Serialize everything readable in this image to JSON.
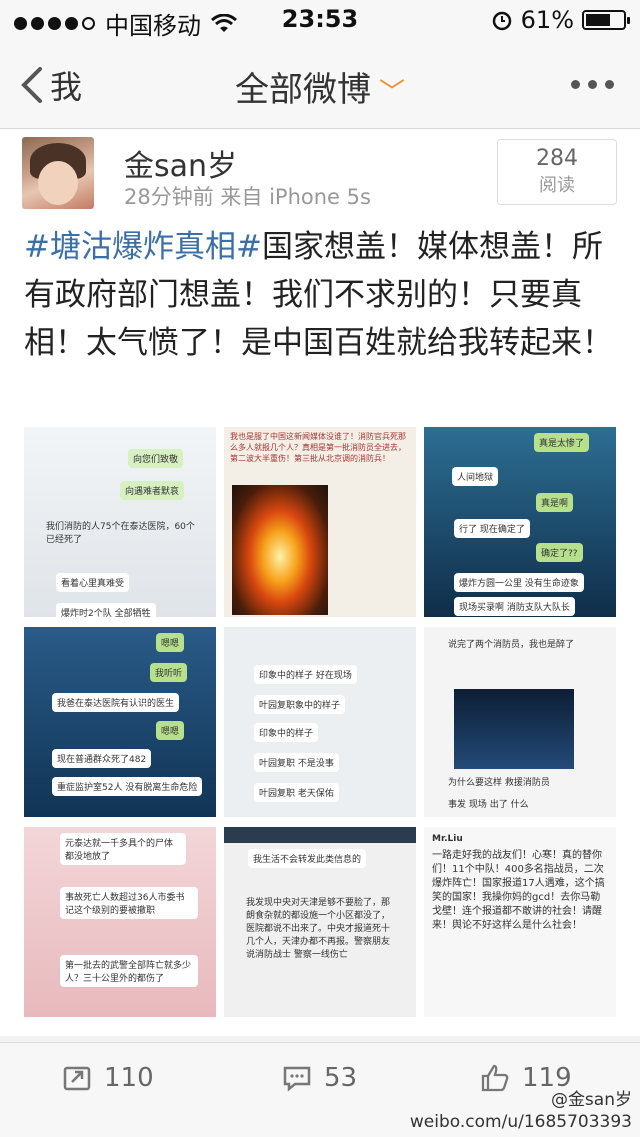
{
  "status": {
    "carrier": "中国移动",
    "time": "23:53",
    "battery": "61%"
  },
  "nav": {
    "back_label": "我",
    "title": "全部微博"
  },
  "post": {
    "username": "金san岁",
    "meta": "28分钟前  来自 iPhone 5s",
    "reads_count": "284",
    "reads_label": "阅读",
    "hashtag": "#塘沽爆炸真相#",
    "text": "国家想盖！媒体想盖！所有政府部门想盖！我们不求别的！只要真相！太气愤了！是中国百姓就给我转起来！"
  },
  "images": [
    {
      "lines": [
        "向您们致敬",
        "向遇难者默哀",
        "我们消防的人75个在泰达医院，60个已经死了",
        "看着心里真难受",
        "爆炸时2个队 全部牺牲"
      ]
    },
    {
      "lines": [
        "我也是服了中国这新闻媒体没谁了！消防官兵死那么多人就报几个人？真相是第一批消防员全进去，第二波大半重伤！第三批从北京调的消防兵！"
      ]
    },
    {
      "lines": [
        "真是太惨了",
        "真是啊",
        "人间地狱",
        "行了 现在确定了",
        "确定了??",
        "爆炸方圆一公里 没有生命迹象",
        "现场买录啊 消防支队大队长"
      ]
    },
    {
      "lines": [
        "嗯嗯",
        "我听听",
        "我爸在泰达医院有认识的医生",
        "嗯嗯",
        "现在普通群众死了482",
        "重症监护室52人 没有脱离生命危险"
      ]
    },
    {
      "lines": [
        "印象中的样子 好在现场",
        "叶园复职象中的样子",
        "印象中的样子",
        "叶园复职 不是没事",
        "叶园复职 老天保佑"
      ]
    },
    {
      "lines": [
        "说完了两个消防员，我也是醉了",
        "为什么要这样 救援消防员",
        "事发 现场 出了 什么"
      ]
    },
    {
      "lines": [
        "元泰达就一千多具个的尸体都没地放了",
        "事故死亡人数超过36人市委书记这个级别的要被撤职",
        "第一批去的武警全部阵亡就多少人？三十公里外的都伤了"
      ]
    },
    {
      "lines": [
        "我生活不会转发此类信息的",
        "我发现中央对天津是够不要脸了，那朗食杂就的都设施一个小区都没了，医院都说不出来了。中央才报道死十几个人，天津办都不再报。警察朋友说消防战士 警察一线伤亡"
      ]
    },
    {
      "lines": [
        "Mr.Liu",
        "一路走好我的战友们！心寒！真的替你们！11个中队！400多名指战员，二次爆炸阵亡！国家报道17人遇难，这个搞笑的国家！我操你妈的gcd！去你马勒戈壁！连个报道都不敢讲的社会！请醒来！舆论不好这样么是什么社会！"
      ]
    }
  ],
  "actions": {
    "repost": "110",
    "comment": "53",
    "like": "119"
  },
  "watermark": {
    "line1": "@金san岁",
    "line2": "weibo.com/u/1685703393"
  },
  "colors": {
    "link": "#3b6fa8",
    "caret": "#f08f2a"
  }
}
